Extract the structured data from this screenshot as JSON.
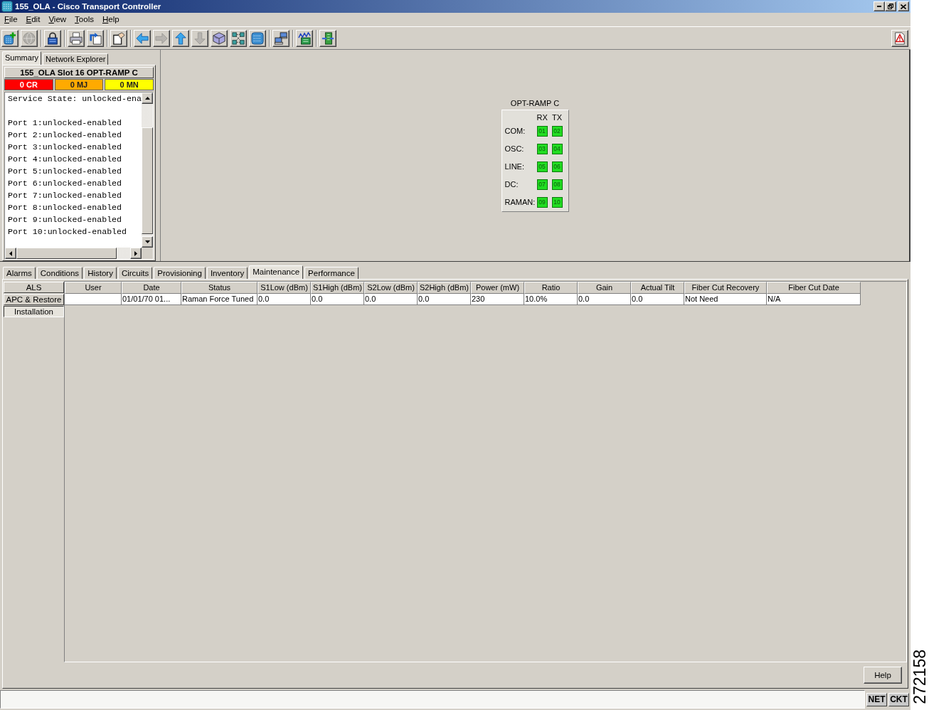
{
  "window": {
    "title": "155_OLA - Cisco Transport Controller"
  },
  "menu": [
    "File",
    "Edit",
    "View",
    "Tools",
    "Help"
  ],
  "toolbar": {
    "groups": [
      [
        {
          "kind": "add",
          "disabled": false
        },
        {
          "kind": "globe",
          "disabled": true
        }
      ],
      [
        {
          "kind": "lock",
          "disabled": false
        }
      ],
      [
        {
          "kind": "print",
          "disabled": false
        },
        {
          "kind": "export",
          "disabled": false
        }
      ],
      [
        {
          "kind": "note",
          "disabled": false
        }
      ],
      [
        {
          "kind": "back",
          "disabled": false
        },
        {
          "kind": "forward",
          "disabled": true
        },
        {
          "kind": "up",
          "disabled": false
        },
        {
          "kind": "down",
          "disabled": true
        },
        {
          "kind": "shelf",
          "disabled": false
        },
        {
          "kind": "topology",
          "disabled": false
        },
        {
          "kind": "node",
          "disabled": false
        }
      ],
      [
        {
          "kind": "hosts",
          "disabled": false
        }
      ],
      [
        {
          "kind": "chart",
          "disabled": false
        }
      ],
      [
        {
          "kind": "card",
          "disabled": false
        }
      ]
    ]
  },
  "summary_panel": {
    "tabs": [
      {
        "label": "Summary",
        "selected": true
      },
      {
        "label": "Network Explorer",
        "selected": false
      }
    ],
    "card_title": "155_OLA Slot 16 OPT-RAMP C",
    "alarm_counts": [
      {
        "label": "0 CR",
        "color": "#ff0000"
      },
      {
        "label": "0 MJ",
        "color": "#ffaa00"
      },
      {
        "label": "0 MN",
        "color": "#ffff00"
      }
    ],
    "service_state": "Service State: unlocked-ena",
    "port_states": [
      "Port 1:unlocked-enabled",
      "Port 2:unlocked-enabled",
      "Port 3:unlocked-enabled",
      "Port 4:unlocked-enabled",
      "Port 5:unlocked-enabled",
      "Port 6:unlocked-enabled",
      "Port 7:unlocked-enabled",
      "Port 8:unlocked-enabled",
      "Port 9:unlocked-enabled",
      "Port 10:unlocked-enabled"
    ]
  },
  "card_view": {
    "title": "OPT-RAMP C",
    "column_headers": [
      "RX",
      "TX"
    ],
    "rows": [
      {
        "label": "COM:",
        "ports": [
          "01",
          "02"
        ]
      },
      {
        "label": "OSC:",
        "ports": [
          "03",
          "04"
        ]
      },
      {
        "label": "LINE:",
        "ports": [
          "05",
          "06"
        ]
      },
      {
        "label": "DC:",
        "ports": [
          "07",
          "08"
        ]
      },
      {
        "label": "RAMAN:",
        "ports": [
          "09",
          "10"
        ]
      }
    ]
  },
  "tabs": [
    {
      "label": "Alarms",
      "selected": false
    },
    {
      "label": "Conditions",
      "selected": false
    },
    {
      "label": "History",
      "selected": false
    },
    {
      "label": "Circuits",
      "selected": false
    },
    {
      "label": "Provisioning",
      "selected": false
    },
    {
      "label": "Inventory",
      "selected": false
    },
    {
      "label": "Maintenance",
      "selected": true
    },
    {
      "label": "Performance",
      "selected": false
    }
  ],
  "maintenance": {
    "subtabs": [
      {
        "label": "ALS",
        "selected": false
      },
      {
        "label": "APC & Restore",
        "selected": false
      },
      {
        "label": "Installation",
        "selected": true
      }
    ],
    "table": {
      "columns": [
        "User",
        "Date",
        "Status",
        "S1Low (dBm)",
        "S1High (dBm)",
        "S2Low (dBm)",
        "S2High (dBm)",
        "Power (mW)",
        "Ratio",
        "Gain",
        "Actual Tilt",
        "Fiber Cut Recovery",
        "Fiber Cut Date"
      ],
      "rows": [
        {
          "cells": [
            null,
            "01/01/70 01...",
            "Raman Force Tuned",
            "0.0",
            "0.0",
            "0.0",
            "0.0",
            "230",
            "10.0%",
            "0.0",
            "0.0",
            "Not Need",
            "N/A"
          ]
        }
      ]
    },
    "help_button": "Help"
  },
  "status_bar": {
    "indicators": [
      "NET",
      "CKT"
    ]
  },
  "figure_number": "272158"
}
